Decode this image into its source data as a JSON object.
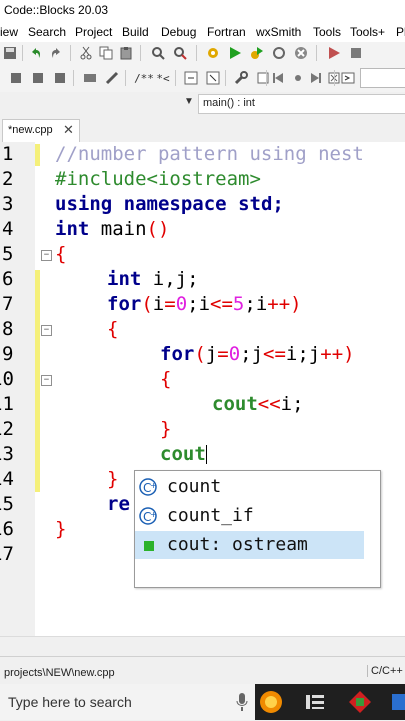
{
  "window": {
    "title": "Code::Blocks 20.03"
  },
  "menu": [
    "iew",
    "Search",
    "Project",
    "Build",
    "Debug",
    "Fortran",
    "wxSmith",
    "Tools",
    "Tools+",
    "Pl"
  ],
  "func_dropdown": {
    "value": "main() : int"
  },
  "tabs": [
    {
      "label": "*new.cpp",
      "close": "✕"
    }
  ],
  "editor": {
    "line_numbers": [
      "1",
      "2",
      "3",
      "4",
      "5",
      "6",
      "7",
      "8",
      "9",
      "10",
      "11",
      "12",
      "13",
      "14",
      "15",
      "16",
      "17"
    ],
    "lines": {
      "l1": "//number pattern using nest",
      "l2": "#include<iostream>",
      "l3_kw1": "using",
      "l3_kw2": "namespace",
      "l3_kw3": "std",
      "l3_p": ";",
      "l4_kw": "int",
      "l4_id": "main",
      "l4_p": "()",
      "l5": "{",
      "l6_kw": "int",
      "l6_id": "i,j;",
      "l7_kw": "for",
      "l7_a": "(",
      "l7_b": "i",
      "l7_c": "=",
      "l7_d": "0",
      "l7_e": ";i",
      "l7_f": "<=",
      "l7_g": "5",
      "l7_h": ";i",
      "l7_i": "++)",
      "l8": "{",
      "l9_kw": "for",
      "l9_a": "(",
      "l9_b": "j",
      "l9_c": "=",
      "l9_d": "0",
      "l9_e": ";j",
      "l9_f": "<=",
      "l9_g": "i;j",
      "l9_h": "++)",
      "l10": "{",
      "l11_kw": "cout",
      "l11_op": "<<",
      "l11_id": "i;",
      "l12": "}",
      "l13_kw": "cout",
      "l14": "}",
      "l15_kw": "re",
      "l16": "}"
    }
  },
  "autocomplete": [
    {
      "label": "count",
      "icon": "class-c-icon"
    },
    {
      "label": "count_if",
      "icon": "class-c-icon"
    },
    {
      "label": "cout: ostream",
      "icon": "variable-green-icon",
      "selected": true
    }
  ],
  "status": {
    "path": "projects\\NEW\\new.cpp",
    "language": "C/C++"
  },
  "taskbar": {
    "search_placeholder": "Type here to search"
  }
}
